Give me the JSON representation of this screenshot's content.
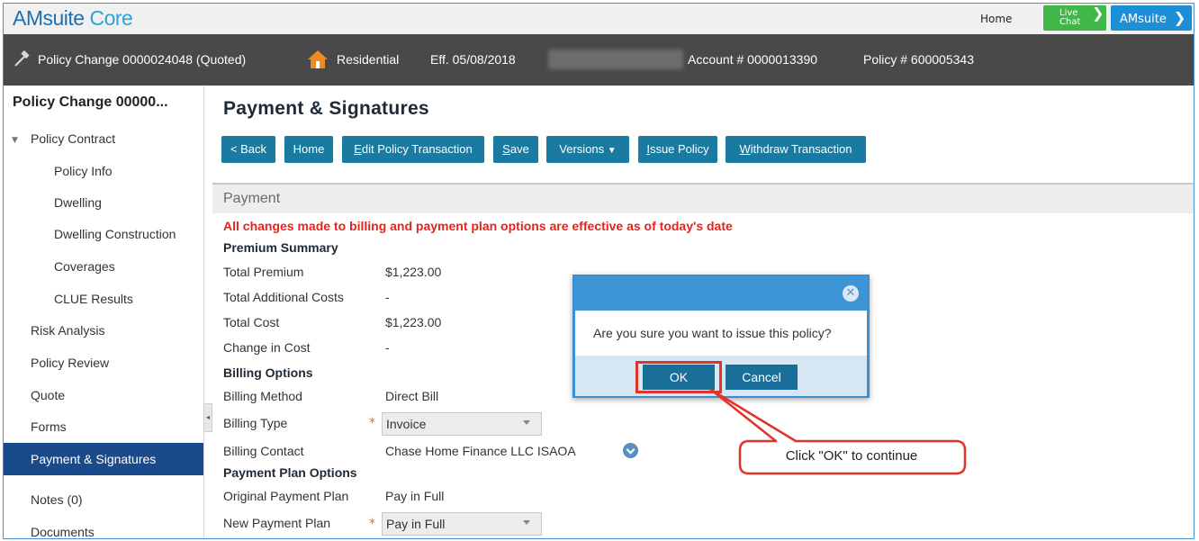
{
  "app": {
    "logo_main": "AMsuite",
    "logo_sub": "Core",
    "home_link": "Home",
    "live_chat": [
      "Live",
      "Chat"
    ],
    "amsuite_button": "AMsuite"
  },
  "header": {
    "policy_change": "Policy Change 0000024048 (Quoted)",
    "line_of_business": "Residential",
    "effective": "Eff. 05/08/2018",
    "account": "Account # 0000013390",
    "policy": "Policy # 600005343"
  },
  "sidebar": {
    "title": "Policy Change 00000...",
    "group_label": "Policy Contract",
    "sub_items": [
      "Policy Info",
      "Dwelling",
      "Dwelling Construction",
      "Coverages",
      "CLUE Results"
    ],
    "items": [
      "Risk Analysis",
      "Policy Review",
      "Quote",
      "Forms",
      "Payment & Signatures",
      "Notes (0)",
      "Documents"
    ]
  },
  "main": {
    "title": "Payment & Signatures",
    "toolbar": {
      "back": "< Back",
      "home": "Home",
      "edit_first": "E",
      "edit_rest": "dit Policy Transaction",
      "save_first": "S",
      "save_rest": "ave",
      "versions": "Versions",
      "issue_first": "I",
      "issue_rest": "ssue Policy",
      "withdraw_first": "W",
      "withdraw_rest": "ithdraw Transaction"
    },
    "section": "Payment",
    "notice": "All changes made to billing and payment plan options are effective as of today's date",
    "premium_summary": {
      "heading": "Premium Summary",
      "rows": [
        {
          "label": "Total Premium",
          "value": "$1,223.00"
        },
        {
          "label": "Total Additional Costs",
          "value": "-"
        },
        {
          "label": "Total Cost",
          "value": "$1,223.00"
        },
        {
          "label": "Change in Cost",
          "value": "-"
        }
      ]
    },
    "billing_options": {
      "heading": "Billing Options",
      "billing_method_label": "Billing Method",
      "billing_method_value": "Direct Bill",
      "billing_type_label": "Billing Type",
      "billing_type_value": "Invoice",
      "billing_contact_label": "Billing Contact",
      "billing_contact_value": "Chase Home Finance LLC ISAOA"
    },
    "payment_plan": {
      "heading": "Payment Plan Options",
      "original_label": "Original Payment Plan",
      "original_value": "Pay in Full",
      "new_label": "New Payment Plan",
      "new_value": "Pay in Full"
    }
  },
  "modal": {
    "message": "Are you sure you want to issue this policy?",
    "ok": "OK",
    "cancel": "Cancel"
  },
  "callout": {
    "text": "Click \"OK\" to continue"
  },
  "colors": {
    "dark_header": "#494949",
    "active_nav": "#1a4a8a",
    "toolbar_button": "#1a7aa0",
    "notice_red": "#e8231a",
    "modal_blue": "#3e95d6",
    "highlight_red": "#e0332a"
  }
}
